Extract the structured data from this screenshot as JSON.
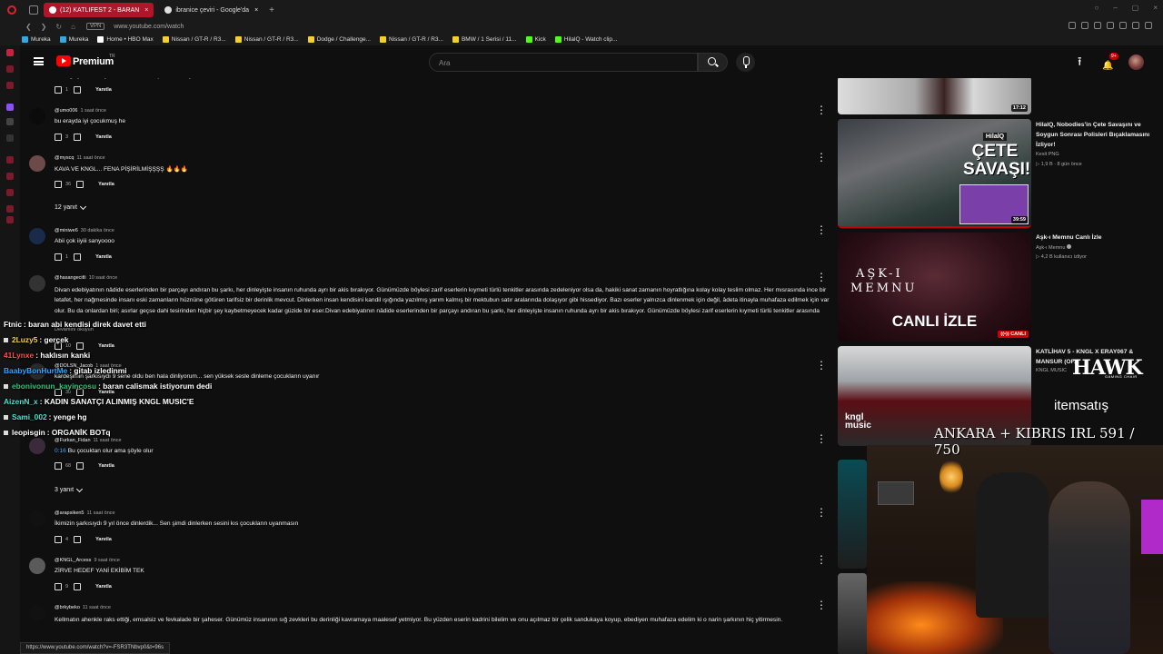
{
  "browser": {
    "tabs": [
      {
        "label": "(12) KATLIFEST 2 - BARAN",
        "active": true
      },
      {
        "label": "ibranice çeviri - Google'da",
        "active": false
      }
    ],
    "url": "www.youtube.com/watch",
    "vpn_label": "VPN",
    "bookmarks": [
      "Mureka",
      "Mureka",
      "Home • HBO Max",
      "Nissan / GT-R / R3...",
      "Nissan / GT-R / R3...",
      "Dodge / Challenge...",
      "Nissan / GT-R / R3...",
      "BMW / 1 Serisi / 11...",
      "Kick",
      "HilalQ - Watch clip..."
    ],
    "bookmark_colors": [
      "#3aa6e0",
      "#3aa6e0",
      "#ffffff",
      "#f2d22a",
      "#f2d22a",
      "#f2d22a",
      "#f2d22a",
      "#f2d22a",
      "#53fc18",
      "#53fc18"
    ],
    "status_url": "https://www.youtube.com/watch?v=-FSR3TNbvp0&t=96s"
  },
  "header": {
    "brand": "Premium",
    "region": "TR",
    "search_placeholder": "Ara",
    "notifications": "9+"
  },
  "comments": [
    {
      "text": "ben ağlayarak dinliyorum sen dinleme çocukların uyanm",
      "likes": "1",
      "reply": "Yanıtla"
    },
    {
      "user": "@umo006",
      "time": "1 saat önce",
      "text": "bu erayda iyi çocukmuş he",
      "likes": "3",
      "reply": "Yanıtla"
    },
    {
      "user": "@myscq",
      "time": "11 saat önce",
      "text": "KAVA VE KNGL... FENA PİŞİRİLMİŞŞŞŞ 🔥🔥🔥",
      "likes": "36",
      "reply": "Yanıtla",
      "replies": "12 yanıt"
    },
    {
      "user": "@miniwe6",
      "time": "30 dakika önce",
      "text": "Abii çok iiyiii sanyoooo",
      "likes": "1",
      "reply": "Yanıtla"
    },
    {
      "user": "@hasangecitli",
      "time": "10 saat önce",
      "text": "Divan edebiyatının nâdide eserlerinden bir parçayı andıran bu şarkı, her dinleyişte insanın ruhunda ayrı bir akis bırakıyor. Günümüzde böylesi zarif eserlerin kıymeti türlü tenkitler arasında zedeleniyor olsa da, hakiki sanat zamanın hoyratlığına kolay kolay teslim olmaz. Her mısrasında ince bir letafet, her nağmesinde insanı eski zamanların hüznüne götüren tarifsiz bir derinlik mevcut. Dinlerken insan kendisini kandil ışığında yazılmış yarım kalmış bir mektubun satır aralarında dolaşıyor gibi hissediyor. Bazı eserler yalnızca dinlenmek için değil, âdeta itinayla muhafaza edilmek için var olur. Bu da onlardan biri; asırlar geçse dahi tesirinden hiçbir şey kaybetmeyecek kadar güzide bir eser.Divan edebiyatının nâdide eserlerinden bir parçayı andıran bu şarkı, her dinleyişte insanın ruhunda ayrı bir akis bırakıyor. Günümüzde böylesi zarif eserlerin kıymeti türlü tenkitler arasında zedeleniyor olsa da, hakiki sanat zamanın hoyratlığına kolay kolay teslim olmaz. Her mısrasında ince bir letafet, her nağmesinde ...",
      "more": "Devamını okuyun",
      "likes": "10",
      "reply": "Yanıtla"
    },
    {
      "user": "@DOLSN_Jacob",
      "time": "1 saat önce",
      "text": "kardeşimin şarkısıydı 9 sene oldu ben hala dinliyorum... sen yüksek sesle dinleme çocukların uyanır",
      "likes": "30",
      "reply": "Yanıtla"
    },
    {
      "user": "@Furkan_Fidan",
      "time": "11 saat önce",
      "timestamp": "0:16",
      "text": "Bu çocuktan olur ama şöyle olur",
      "likes": "68",
      "reply": "Yanıtla",
      "replies": "3 yanıt"
    },
    {
      "user": "@arapsiken5",
      "time": "11 saat önce",
      "text": "İkimizin şarkısıydı 9 yıl önce dinlerdik... Sen şimdi dinlerken sesini kıs çocukların uyanmasın",
      "likes": "4",
      "reply": "Yanıtla"
    },
    {
      "user": "@KNGL_Arcess",
      "time": "9 saat önce",
      "text": "ZİRVE HEDEF YANİ EKİBİM TEK",
      "likes": "9",
      "reply": "Yanıtla"
    },
    {
      "user": "@brkybeko",
      "time": "11 saat önce",
      "text": "Kellmatın ahenkle raks ettiği, emsalsiz ve fevkalade bir şaheser. Günümüz insanının sığ zevkleri bu derinliği kavramaya maalesef yetmiyor. Bu yüzden eserin kadrini bilelim ve onu açılmaz bir çelik sandukaya koyup, ebediyen muhafaza edelim ki o narin şarkının hiç yitirmesin."
    }
  ],
  "chat": [
    {
      "user": "Ftnic",
      "msg": ": baran abi kendisi direk davet etti",
      "color": "#ffffff"
    },
    {
      "user": "2Luzy5",
      "msg": ": gerçek",
      "color": "#f5d442"
    },
    {
      "user": "41Lynxe",
      "msg": ": haklısın kanki",
      "color": "#ff4d4d"
    },
    {
      "user": "BaabyBonHurtMe",
      "msg": ": gitab izledinmi",
      "color": "#2ea8ff"
    },
    {
      "user": "ebonivonun_kayincosu",
      "msg": ": baran calismak istiyorum dedi",
      "color": "#2ec27e"
    },
    {
      "user": "AizenN_x",
      "msg": ": KADIN SANATÇI ALINMIŞ KNGL MUSIC'E",
      "color": "#4ee0d2"
    },
    {
      "user": "Sami_002",
      "msg": ": yenge hg",
      "color": "#4ee0d2"
    },
    {
      "user": "leopisgin",
      "msg": ": ORGANİK BOTq",
      "color": "#ffffff"
    }
  ],
  "sidebar_videos": [
    {
      "duration": "17:12"
    },
    {
      "title": "HilalQ, Nobodies'in Çete Savaşını ve Soygun Sonrası Polisleri Bıçaklamasını İzliyor!",
      "channel": "Kesit PNG",
      "meta": "1,9 B · 8 gün önce",
      "duration": "39:59",
      "thumb_text": [
        "HilalQ",
        "ÇETE",
        "SAVAŞI!"
      ]
    },
    {
      "title": "Aşk-ı Memnu Canlı İzle",
      "channel": "Aşk-ı Memnu",
      "meta": "4,2 B kullanıcı izliyor",
      "live": "CANLI",
      "thumb_text": [
        "AŞK-I",
        "MEMNU",
        "CANLI İZLE"
      ]
    },
    {
      "title": "KATLİHAV 5 - KNGL X ERAY067 & MANSUR (OF...",
      "channel": "KNGL MUSIC",
      "thumb_text": [
        "kngl",
        "music"
      ]
    }
  ],
  "overlay": {
    "hawk": "HAWK",
    "hawk_sub": "GAMING CHAIR",
    "sponsor": "itemsatış",
    "stream_title": "ANKARA + KIBRIS IRL 591 / 750"
  }
}
